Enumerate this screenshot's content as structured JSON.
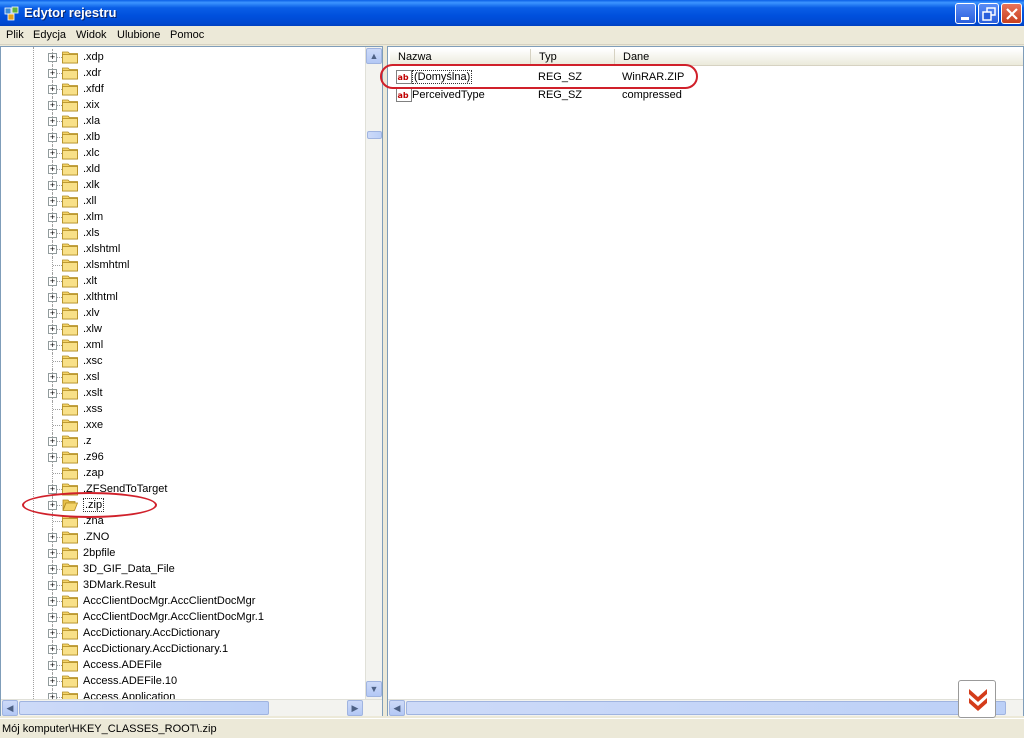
{
  "window": {
    "title": "Edytor rejestru",
    "buttons": [
      "minimize",
      "maximize",
      "close"
    ]
  },
  "menu": [
    "Plik",
    "Edycja",
    "Widok",
    "Ulubione",
    "Pomoc"
  ],
  "tree": {
    "items": [
      {
        "label": ".xdp",
        "expandable": true
      },
      {
        "label": ".xdr",
        "expandable": true
      },
      {
        "label": ".xfdf",
        "expandable": true
      },
      {
        "label": ".xix",
        "expandable": true
      },
      {
        "label": ".xla",
        "expandable": true
      },
      {
        "label": ".xlb",
        "expandable": true
      },
      {
        "label": ".xlc",
        "expandable": true
      },
      {
        "label": ".xld",
        "expandable": true
      },
      {
        "label": ".xlk",
        "expandable": true
      },
      {
        "label": ".xll",
        "expandable": true
      },
      {
        "label": ".xlm",
        "expandable": true
      },
      {
        "label": ".xls",
        "expandable": true
      },
      {
        "label": ".xlshtml",
        "expandable": true
      },
      {
        "label": ".xlsmhtml",
        "expandable": false
      },
      {
        "label": ".xlt",
        "expandable": true
      },
      {
        "label": ".xlthtml",
        "expandable": true
      },
      {
        "label": ".xlv",
        "expandable": true
      },
      {
        "label": ".xlw",
        "expandable": true
      },
      {
        "label": ".xml",
        "expandable": true
      },
      {
        "label": ".xsc",
        "expandable": false
      },
      {
        "label": ".xsl",
        "expandable": true
      },
      {
        "label": ".xslt",
        "expandable": true
      },
      {
        "label": ".xss",
        "expandable": false
      },
      {
        "label": ".xxe",
        "expandable": false
      },
      {
        "label": ".z",
        "expandable": true
      },
      {
        "label": ".z96",
        "expandable": true
      },
      {
        "label": ".zap",
        "expandable": false
      },
      {
        "label": ".ZFSendToTarget",
        "expandable": true
      },
      {
        "label": ".zip",
        "expandable": true,
        "selected": true,
        "open": true
      },
      {
        "label": ".zna",
        "expandable": false
      },
      {
        "label": ".ZNO",
        "expandable": true
      },
      {
        "label": "2bpfile",
        "expandable": true
      },
      {
        "label": "3D_GIF_Data_File",
        "expandable": true
      },
      {
        "label": "3DMark.Result",
        "expandable": true
      },
      {
        "label": "AccClientDocMgr.AccClientDocMgr",
        "expandable": true
      },
      {
        "label": "AccClientDocMgr.AccClientDocMgr.1",
        "expandable": true
      },
      {
        "label": "AccDictionary.AccDictionary",
        "expandable": true
      },
      {
        "label": "AccDictionary.AccDictionary.1",
        "expandable": true
      },
      {
        "label": "Access.ADEFile",
        "expandable": true
      },
      {
        "label": "Access.ADEFile.10",
        "expandable": true
      },
      {
        "label": "Access.Application",
        "expandable": true
      }
    ]
  },
  "values": {
    "columns": [
      "Nazwa",
      "Typ",
      "Dane"
    ],
    "rows": [
      {
        "name": "(Domyślna)",
        "type": "REG_SZ",
        "data": "WinRAR.ZIP"
      },
      {
        "name": "PerceivedType",
        "type": "REG_SZ",
        "data": "compressed"
      }
    ]
  },
  "status": {
    "path": "Mój komputer\\HKEY_CLASSES_ROOT\\.zip"
  },
  "colors": {
    "title_blue": "#0050dd",
    "folder_yellow": "#f4d46a",
    "annotation_red": "#d0202a"
  }
}
